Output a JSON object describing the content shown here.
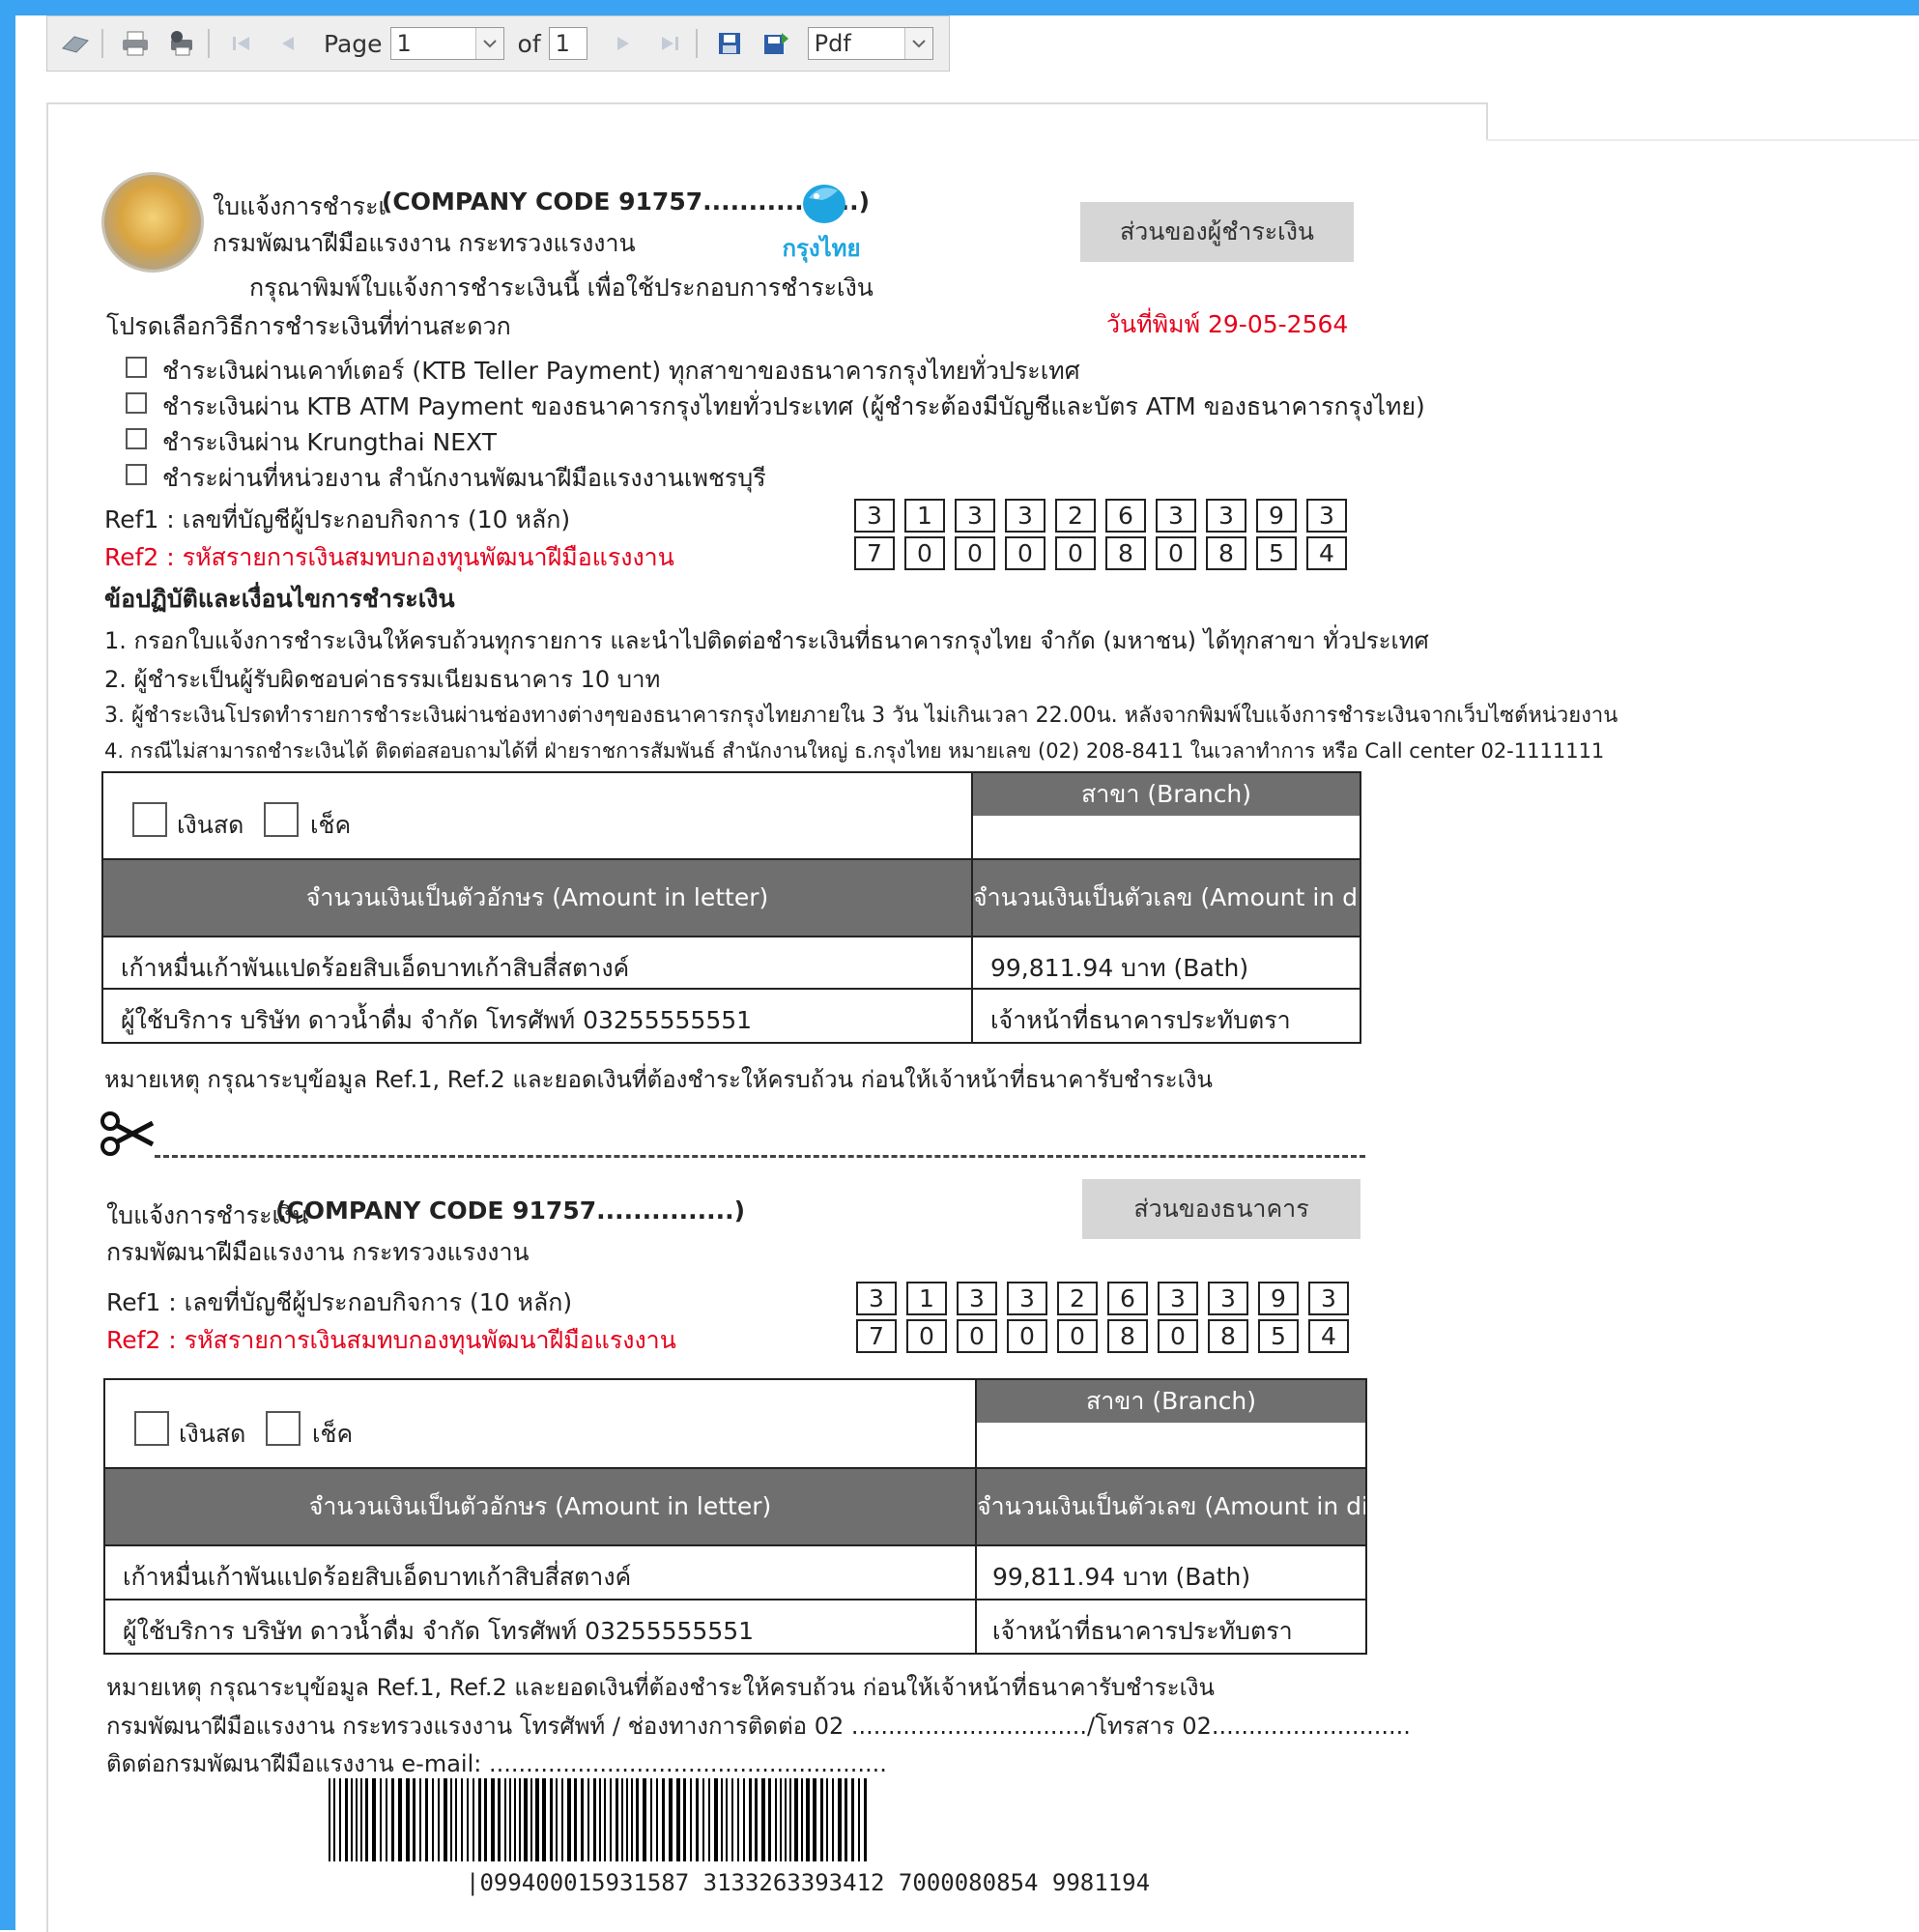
{
  "toolbar": {
    "page_label": "Page",
    "page_value": "1",
    "of_label": "of",
    "total_pages": "1",
    "export_format": "Pdf",
    "icons": [
      "refresh-icon",
      "print-icon",
      "print-options-icon",
      "first-page-icon",
      "prev-page-icon",
      "next-page-icon",
      "last-page-icon",
      "save-icon",
      "export-icon"
    ]
  },
  "upper": {
    "title_prefix": "ใบแจ้งการชำระเ",
    "company_code": "(COMPANY CODE 91757.................)",
    "department": "กรมพัฒนาฝีมือแรงงาน กระทรวงแรงงาน",
    "print_instruction": "กรุณาพิมพ์ใบแจ้งการชำระเงินนี้ เพื่อใช้ประกอบการชำระเงิน",
    "bank_logo_text": "กรุงไทย",
    "copy_label": "ส่วนของผู้ชำระเงิน",
    "print_date": "วันที่พิมพ์ 29-05-2564",
    "choose_method": "โปรดเลือกวิธีการชำระเงินที่ท่านสะดวก",
    "methods": [
      "ชำระเงินผ่านเคาท์เตอร์ (KTB Teller Payment) ทุกสาขาของธนาคารกรุงไทยทั่วประเทศ",
      "ชำระเงินผ่าน KTB ATM Payment ของธนาคารกรุงไทยทั่วประเทศ (ผู้ชำระต้องมีบัญชีและบัตร ATM ของธนาคารกรุงไทย)",
      "ชำระเงินผ่าน Krungthai NEXT",
      "ชำระผ่านที่หน่วยงาน สำนักงานพัฒนาฝีมือแรงงานเพชรบุรี"
    ],
    "ref1_label": "Ref1 : เลขที่บัญชีผู้ประกอบกิจการ (10 หลัก)",
    "ref2_label": "Ref2 : รหัสรายการเงินสมทบกองทุนพัฒนาฝีมือแรงงาน",
    "ref1_digits": [
      "3",
      "1",
      "3",
      "3",
      "2",
      "6",
      "3",
      "3",
      "9",
      "3"
    ],
    "ref2_digits": [
      "7",
      "0",
      "0",
      "0",
      "0",
      "8",
      "0",
      "8",
      "5",
      "4"
    ],
    "conditions_title": "ข้อปฏิบัติและเงื่อนไขการชำระเงิน",
    "conditions": [
      "1. กรอกใบแจ้งการชำระเงินให้ครบถ้วนทุกรายการ และนำไปติดต่อชำระเงินที่ธนาคารกรุงไทย จำกัด (มหาชน) ได้ทุกสาขา ทั่วประเทศ",
      "2. ผู้ชำระเป็นผู้รับผิดชอบค่าธรรมเนียมธนาคาร 10 บาท",
      "3. ผู้ชำระเงินโปรดทำรายการชำระเงินผ่านช่องทางต่างๆของธนาคารกรุงไทยภายใน 3 วัน ไม่เกินเวลา 22.00น. หลังจากพิมพ์ใบแจ้งการชำระเงินจากเว็บไซต์หน่วยงาน",
      "4. กรณีไม่สามารถชำระเงินได้ ติดต่อสอบถามได้ที่ ฝ่ายราชการสัมพันธ์ สำนักงานใหญ่ ธ.กรุงไทย หมายเลข (02) 208-8411 ในเวลาทำการ หรือ Call center 02-1111111"
    ],
    "note": "หมายเหตุ กรุณาระบุข้อมูล Ref.1, Ref.2 และยอดเงินที่ต้องชำระให้ครบถ้วน ก่อนให้เจ้าหน้าที่ธนาคารับชำระเงิน"
  },
  "payment_table": {
    "cash_label": "เงินสด",
    "cheque_label": "เช็ค",
    "branch_header": "สาขา (Branch)",
    "amount_letter_header": "จำนวนเงินเป็นตัวอักษร (Amount in letter)",
    "amount_digit_header": "จำนวนเงินเป็นตัวเลข (Amount in di",
    "amount_letter": "เก้าหมื่นเก้าพันแปดร้อยสิบเอ็ดบาทเก้าสิบสี่สตางค์",
    "amount_digit": "99,811.94 บาท (Bath)",
    "payer": "ผู้ใช้บริการ บริษัท ดาวน้ำดื่ม จำกัด โทรศัพท์ 03255555551",
    "stamp_label": "เจ้าหน้าที่ธนาคารประทับตรา"
  },
  "lower": {
    "title_prefix": "ใบแจ้งการชำระเงิน",
    "company_code": "(COMPANY CODE 91757...............)",
    "department": "กรมพัฒนาฝีมือแรงงาน กระทรวงแรงงาน",
    "copy_label": "ส่วนของธนาคาร",
    "contact_line": "กรมพัฒนาฝีมือแรงงาน กระทรวงแรงงาน โทรศัพท์ / ช่องทางการติดต่อ 02 ................................/โทรสาร 02...........................",
    "email_line": "ติดต่อกรมพัฒนาฝีมือแรงงาน e-mail: ......................................................",
    "barcode_text": "|099400015931587 3133263393412 7000080854 9981194"
  },
  "colors": {
    "frame": "#3aa3f2",
    "header_gray": "#6f6f6f",
    "button_gray": "#d6d6d6",
    "accent_red": "#e5001c",
    "ktb_blue": "#1ea5e0"
  }
}
